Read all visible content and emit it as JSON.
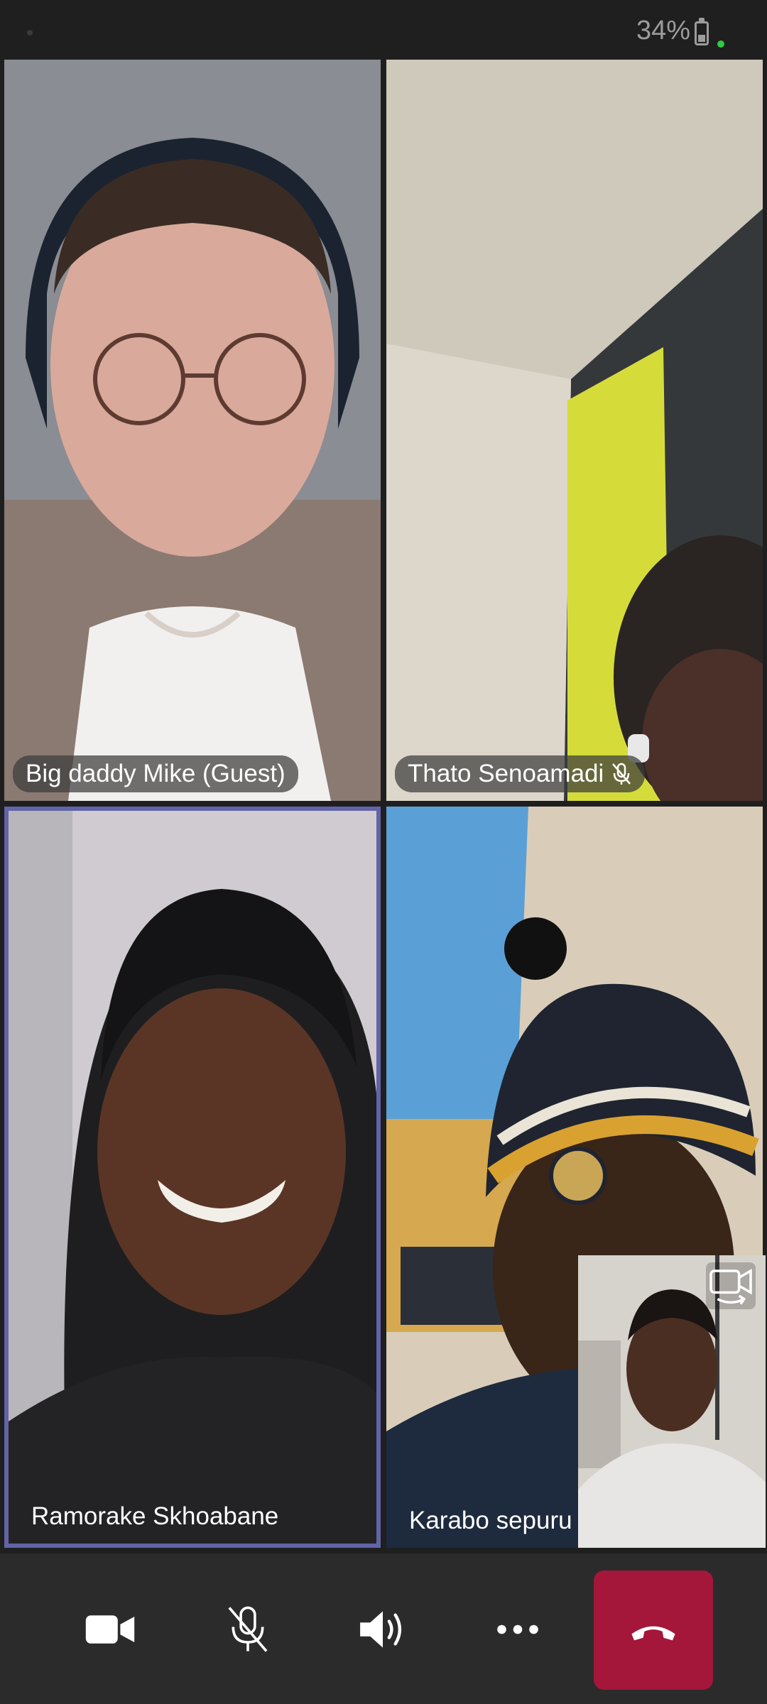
{
  "status_bar": {
    "battery": "34%"
  },
  "participants": [
    {
      "name": "Big daddy Mike (Guest)",
      "muted": false
    },
    {
      "name": "Thato Senoamadi",
      "muted": true
    },
    {
      "name": "Ramorake Skhoabane",
      "muted": false,
      "active_speaker": true
    },
    {
      "name": "Karabo sepuru",
      "muted": false
    }
  ],
  "controls": {
    "video_icon": "video-camera-icon",
    "mic_icon": "microphone-off-icon",
    "speaker_icon": "speaker-icon",
    "more_icon": "more-options-icon",
    "hangup_icon": "hang-up-icon"
  },
  "colors": {
    "active_border": "#6264a7",
    "hangup": "#a4163a"
  }
}
